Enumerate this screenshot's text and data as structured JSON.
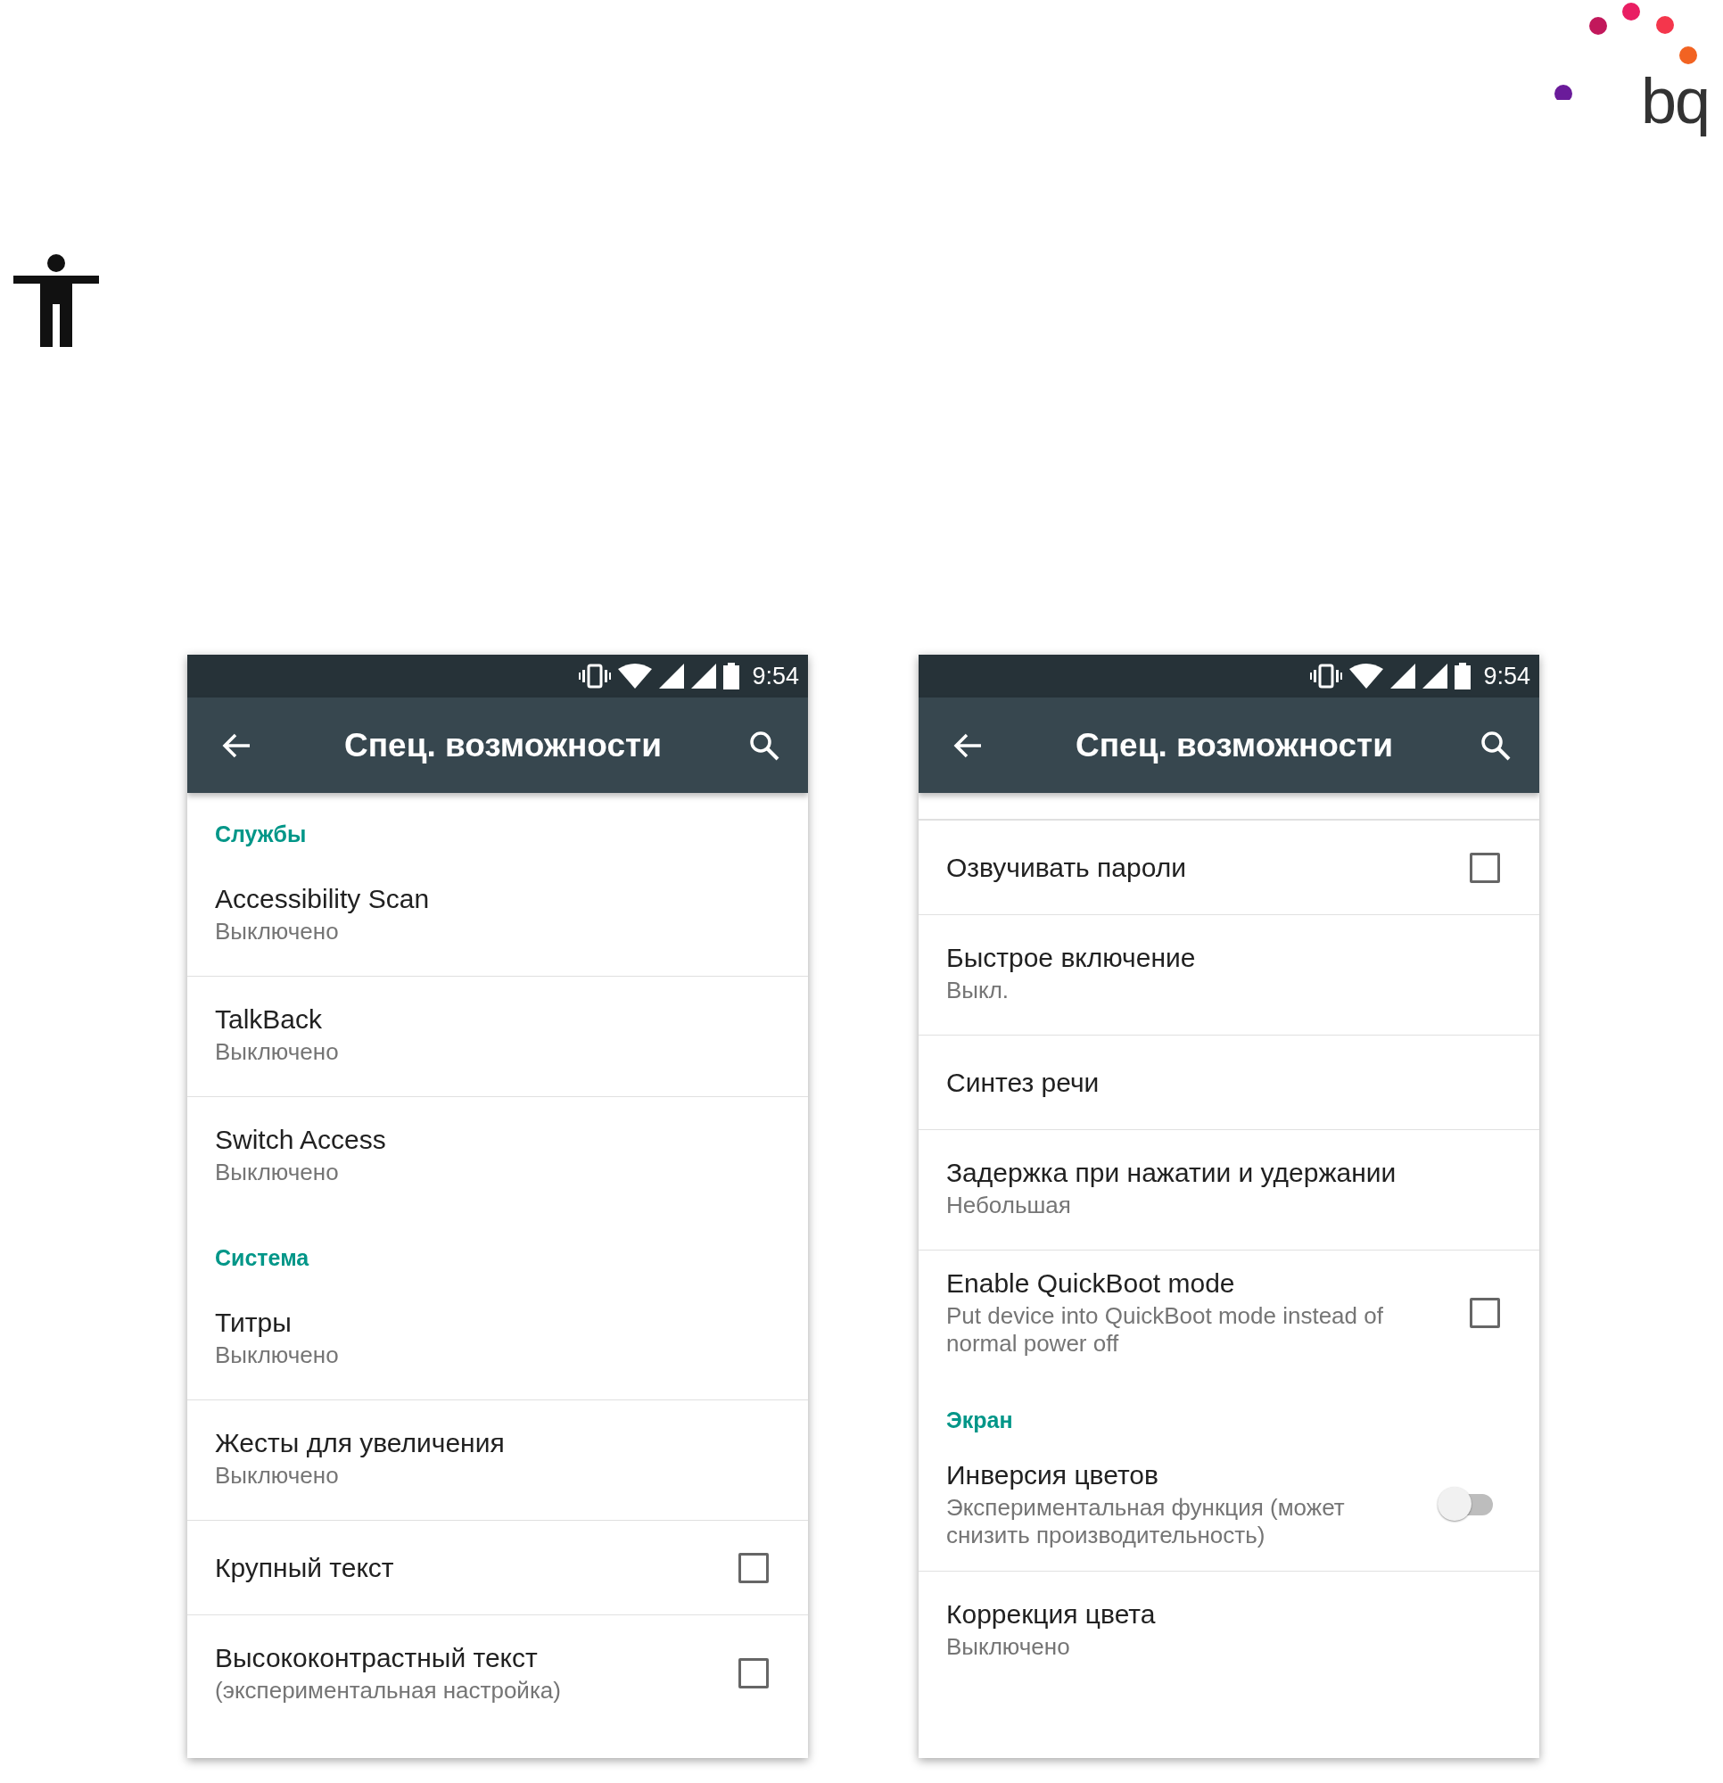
{
  "logo": {
    "text": "bq"
  },
  "screens": [
    {
      "status_bar": {
        "time": "9:54"
      },
      "toolbar": {
        "title": "Спец. возможности"
      },
      "scrolled": false,
      "items": [
        {
          "kind": "header",
          "title": "Службы"
        },
        {
          "kind": "item",
          "title": "Accessibility Scan",
          "summary": "Выключено"
        },
        {
          "kind": "item",
          "title": "TalkBack",
          "summary": "Выключено"
        },
        {
          "kind": "item",
          "title": "Switch Access",
          "summary": "Выключено"
        },
        {
          "kind": "header",
          "title": "Система"
        },
        {
          "kind": "item",
          "title": "Титры",
          "summary": "Выключено"
        },
        {
          "kind": "item",
          "title": "Жесты для увеличения",
          "summary": "Выключено"
        },
        {
          "kind": "checkbox",
          "title": "Крупный текст",
          "checked": false
        },
        {
          "kind": "checkbox",
          "title": "Высококонтрастный текст",
          "summary": "(экспериментальная настройка)",
          "checked": false
        }
      ]
    },
    {
      "status_bar": {
        "time": "9:54"
      },
      "toolbar": {
        "title": "Спец. возможности"
      },
      "scrolled": true,
      "items": [
        {
          "kind": "checkbox",
          "title": "Озвучивать пароли",
          "checked": false
        },
        {
          "kind": "item",
          "title": "Быстрое включение",
          "summary": "Выкл."
        },
        {
          "kind": "item",
          "title": "Синтез речи"
        },
        {
          "kind": "item",
          "title": "Задержка при нажатии и удержании",
          "summary": "Небольшая"
        },
        {
          "kind": "checkbox",
          "title": "Enable QuickBoot mode",
          "summary": "Put device into QuickBoot mode instead of normal power off",
          "checked": false
        },
        {
          "kind": "header",
          "title": "Экран"
        },
        {
          "kind": "switch",
          "title": "Инверсия цветов",
          "summary": "Экспериментальная функция (может снизить производительность)",
          "on": false
        },
        {
          "kind": "item",
          "title": "Коррекция цвета",
          "summary": "Выключено"
        }
      ]
    }
  ]
}
